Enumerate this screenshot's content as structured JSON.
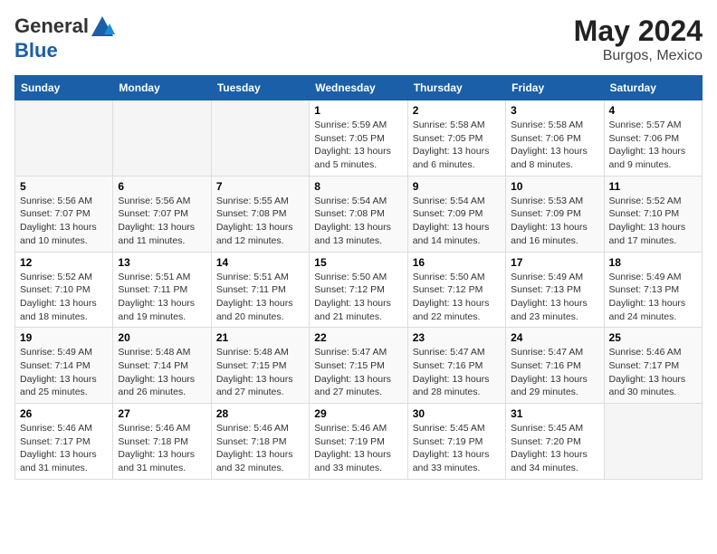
{
  "header": {
    "logo_line1": "General",
    "logo_line2": "Blue",
    "month_year": "May 2024",
    "location": "Burgos, Mexico"
  },
  "days_of_week": [
    "Sunday",
    "Monday",
    "Tuesday",
    "Wednesday",
    "Thursday",
    "Friday",
    "Saturday"
  ],
  "weeks": [
    [
      {
        "day": "",
        "empty": true
      },
      {
        "day": "",
        "empty": true
      },
      {
        "day": "",
        "empty": true
      },
      {
        "day": "1",
        "sunrise": "5:59 AM",
        "sunset": "7:05 PM",
        "daylight": "13 hours and 5 minutes."
      },
      {
        "day": "2",
        "sunrise": "5:58 AM",
        "sunset": "7:05 PM",
        "daylight": "13 hours and 6 minutes."
      },
      {
        "day": "3",
        "sunrise": "5:58 AM",
        "sunset": "7:06 PM",
        "daylight": "13 hours and 8 minutes."
      },
      {
        "day": "4",
        "sunrise": "5:57 AM",
        "sunset": "7:06 PM",
        "daylight": "13 hours and 9 minutes."
      }
    ],
    [
      {
        "day": "5",
        "sunrise": "5:56 AM",
        "sunset": "7:07 PM",
        "daylight": "13 hours and 10 minutes."
      },
      {
        "day": "6",
        "sunrise": "5:56 AM",
        "sunset": "7:07 PM",
        "daylight": "13 hours and 11 minutes."
      },
      {
        "day": "7",
        "sunrise": "5:55 AM",
        "sunset": "7:08 PM",
        "daylight": "13 hours and 12 minutes."
      },
      {
        "day": "8",
        "sunrise": "5:54 AM",
        "sunset": "7:08 PM",
        "daylight": "13 hours and 13 minutes."
      },
      {
        "day": "9",
        "sunrise": "5:54 AM",
        "sunset": "7:09 PM",
        "daylight": "13 hours and 14 minutes."
      },
      {
        "day": "10",
        "sunrise": "5:53 AM",
        "sunset": "7:09 PM",
        "daylight": "13 hours and 16 minutes."
      },
      {
        "day": "11",
        "sunrise": "5:52 AM",
        "sunset": "7:10 PM",
        "daylight": "13 hours and 17 minutes."
      }
    ],
    [
      {
        "day": "12",
        "sunrise": "5:52 AM",
        "sunset": "7:10 PM",
        "daylight": "13 hours and 18 minutes."
      },
      {
        "day": "13",
        "sunrise": "5:51 AM",
        "sunset": "7:11 PM",
        "daylight": "13 hours and 19 minutes."
      },
      {
        "day": "14",
        "sunrise": "5:51 AM",
        "sunset": "7:11 PM",
        "daylight": "13 hours and 20 minutes."
      },
      {
        "day": "15",
        "sunrise": "5:50 AM",
        "sunset": "7:12 PM",
        "daylight": "13 hours and 21 minutes."
      },
      {
        "day": "16",
        "sunrise": "5:50 AM",
        "sunset": "7:12 PM",
        "daylight": "13 hours and 22 minutes."
      },
      {
        "day": "17",
        "sunrise": "5:49 AM",
        "sunset": "7:13 PM",
        "daylight": "13 hours and 23 minutes."
      },
      {
        "day": "18",
        "sunrise": "5:49 AM",
        "sunset": "7:13 PM",
        "daylight": "13 hours and 24 minutes."
      }
    ],
    [
      {
        "day": "19",
        "sunrise": "5:49 AM",
        "sunset": "7:14 PM",
        "daylight": "13 hours and 25 minutes."
      },
      {
        "day": "20",
        "sunrise": "5:48 AM",
        "sunset": "7:14 PM",
        "daylight": "13 hours and 26 minutes."
      },
      {
        "day": "21",
        "sunrise": "5:48 AM",
        "sunset": "7:15 PM",
        "daylight": "13 hours and 27 minutes."
      },
      {
        "day": "22",
        "sunrise": "5:47 AM",
        "sunset": "7:15 PM",
        "daylight": "13 hours and 27 minutes."
      },
      {
        "day": "23",
        "sunrise": "5:47 AM",
        "sunset": "7:16 PM",
        "daylight": "13 hours and 28 minutes."
      },
      {
        "day": "24",
        "sunrise": "5:47 AM",
        "sunset": "7:16 PM",
        "daylight": "13 hours and 29 minutes."
      },
      {
        "day": "25",
        "sunrise": "5:46 AM",
        "sunset": "7:17 PM",
        "daylight": "13 hours and 30 minutes."
      }
    ],
    [
      {
        "day": "26",
        "sunrise": "5:46 AM",
        "sunset": "7:17 PM",
        "daylight": "13 hours and 31 minutes."
      },
      {
        "day": "27",
        "sunrise": "5:46 AM",
        "sunset": "7:18 PM",
        "daylight": "13 hours and 31 minutes."
      },
      {
        "day": "28",
        "sunrise": "5:46 AM",
        "sunset": "7:18 PM",
        "daylight": "13 hours and 32 minutes."
      },
      {
        "day": "29",
        "sunrise": "5:46 AM",
        "sunset": "7:19 PM",
        "daylight": "13 hours and 33 minutes."
      },
      {
        "day": "30",
        "sunrise": "5:45 AM",
        "sunset": "7:19 PM",
        "daylight": "13 hours and 33 minutes."
      },
      {
        "day": "31",
        "sunrise": "5:45 AM",
        "sunset": "7:20 PM",
        "daylight": "13 hours and 34 minutes."
      },
      {
        "day": "",
        "empty": true
      }
    ]
  ],
  "labels": {
    "sunrise_prefix": "Sunrise: ",
    "sunset_prefix": "Sunset: ",
    "daylight_prefix": "Daylight hours"
  }
}
